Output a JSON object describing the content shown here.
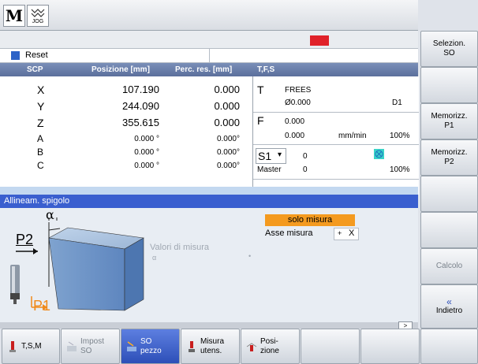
{
  "top": {
    "logo": "M",
    "jog_label": "JOG"
  },
  "status": {
    "reset_label": "Reset"
  },
  "table": {
    "headers": {
      "scp": "SCP",
      "pos": "Posizione [mm]",
      "perc": "Perc. res. [mm]",
      "tfs": "T,F,S"
    },
    "rows": [
      {
        "axis": "X",
        "pos": "107.190",
        "perc": "0.000"
      },
      {
        "axis": "Y",
        "pos": "244.090",
        "perc": "0.000"
      },
      {
        "axis": "Z",
        "pos": "355.615",
        "perc": "0.000"
      },
      {
        "axis": "A",
        "pos": "0.000 °",
        "perc": "0.000°"
      },
      {
        "axis": "B",
        "pos": "0.000 °",
        "perc": "0.000°"
      },
      {
        "axis": "C",
        "pos": "0.000 °",
        "perc": "0.000°"
      }
    ]
  },
  "tfs": {
    "t_label": "T",
    "tool": "FREES",
    "diam": "Ø0.000",
    "d": "D1",
    "f_label": "F",
    "f_val": "0.000",
    "f_val2": "0.000",
    "f_unit": "mm/min",
    "f_pct": "100%",
    "s_label": "S1",
    "s_val": "0",
    "s_pct": "100%",
    "master_label": "Master",
    "master_val": "0"
  },
  "panel": {
    "title": "Allineam. spigolo",
    "solo_misura": "solo misura",
    "asse_label": "Asse misura",
    "asse_sign": "+",
    "asse_val": "X",
    "valori": "Valori di misura",
    "valori_sub": "α",
    "alpha": "α",
    "p1": "P1",
    "p2": "P2"
  },
  "softkeys": {
    "k1": "Selezion.\nSO",
    "k3": "Memorizz.\nP1",
    "k4": "Memorizz.\nP2",
    "k7": "Calcolo",
    "k8_arrow": "«",
    "k8": "Indietro"
  },
  "bottom": {
    "b1": "T,S,M",
    "b2": "Impost\nSO",
    "b3": "SO\npezzo",
    "b4": "Misura\nutens.",
    "b5": "Posi-\nzione",
    "scroll_arrow": ">"
  }
}
